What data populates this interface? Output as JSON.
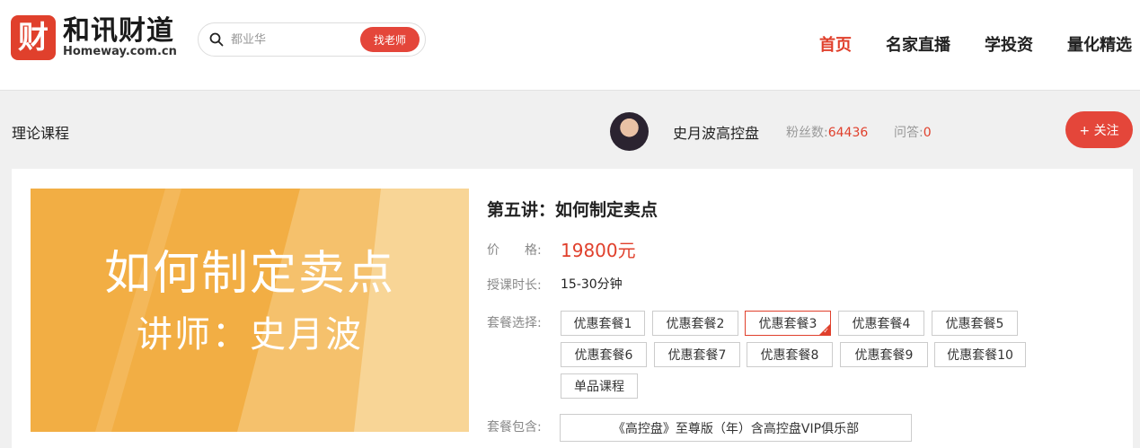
{
  "header": {
    "logo_mark": "财",
    "logo_cn": "和讯财道",
    "logo_en": "Homeway.com.cn",
    "search_placeholder": "都业华",
    "search_button": "找老师",
    "nav": [
      {
        "label": "首页",
        "active": true
      },
      {
        "label": "名家直播",
        "active": false
      },
      {
        "label": "学投资",
        "active": false
      },
      {
        "label": "量化精选",
        "active": false
      }
    ]
  },
  "subbar": {
    "breadcrumb": "理论课程",
    "teacher_name": "史月波高控盘",
    "fans_label": "粉丝数:",
    "fans_count": "64436",
    "qa_label": "问答:",
    "qa_count": "0",
    "follow_button": "+ 关注"
  },
  "course": {
    "cover_title": "如何制定卖点",
    "cover_subtitle": "讲师：史月波",
    "title": "第五讲：如何制定卖点",
    "price_label": "价　　格:",
    "price_value": "19800元",
    "duration_label": "授课时长:",
    "duration_value": "15-30分钟",
    "package_label": "套餐选择:",
    "packages": [
      {
        "label": "优惠套餐1",
        "selected": false
      },
      {
        "label": "优惠套餐2",
        "selected": false
      },
      {
        "label": "优惠套餐3",
        "selected": true
      },
      {
        "label": "优惠套餐4",
        "selected": false
      },
      {
        "label": "优惠套餐5",
        "selected": false
      },
      {
        "label": "优惠套餐6",
        "selected": false
      },
      {
        "label": "优惠套餐7",
        "selected": false
      },
      {
        "label": "优惠套餐8",
        "selected": false
      },
      {
        "label": "优惠套餐9",
        "selected": false
      },
      {
        "label": "优惠套餐10",
        "selected": false
      },
      {
        "label": "单品课程",
        "selected": false
      }
    ],
    "includes_label": "套餐包含:",
    "includes_value": "《高控盘》至尊版（年）含高控盘VIP俱乐部"
  },
  "colors": {
    "accent": "#e0402c",
    "cover_bg": "#f2ae44"
  }
}
